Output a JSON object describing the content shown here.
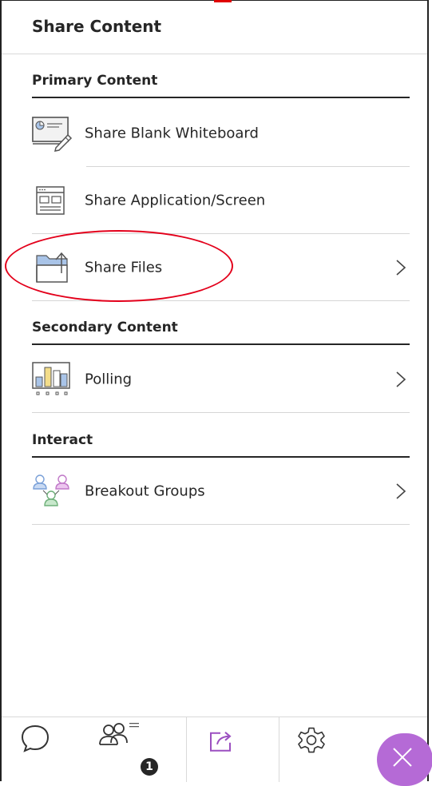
{
  "header": {
    "title": "Share Content"
  },
  "sections": {
    "primary": "Primary Content",
    "secondary": "Secondary Content",
    "interact": "Interact"
  },
  "items": {
    "whiteboard": {
      "label": "Share Blank Whiteboard",
      "icon": "whiteboard-icon"
    },
    "application": {
      "label": "Share Application/Screen",
      "icon": "application-screen-icon"
    },
    "files": {
      "label": "Share Files",
      "icon": "folder-upload-icon"
    },
    "polling": {
      "label": "Polling",
      "icon": "polling-chart-icon"
    },
    "breakout": {
      "label": "Breakout Groups",
      "icon": "breakout-groups-icon"
    }
  },
  "bottom_bar": {
    "tabs": [
      {
        "name": "chat",
        "icon": "chat-bubble-icon"
      },
      {
        "name": "attendees",
        "icon": "attendees-icon",
        "badge": "1"
      },
      {
        "name": "share-content",
        "icon": "share-icon",
        "active": true
      },
      {
        "name": "settings",
        "icon": "gear-icon"
      }
    ],
    "close_icon": "close-icon"
  },
  "colors": {
    "accent": "#b56ad6",
    "annotation": "#e3001b",
    "divider": "#262626",
    "text": "#262626"
  }
}
